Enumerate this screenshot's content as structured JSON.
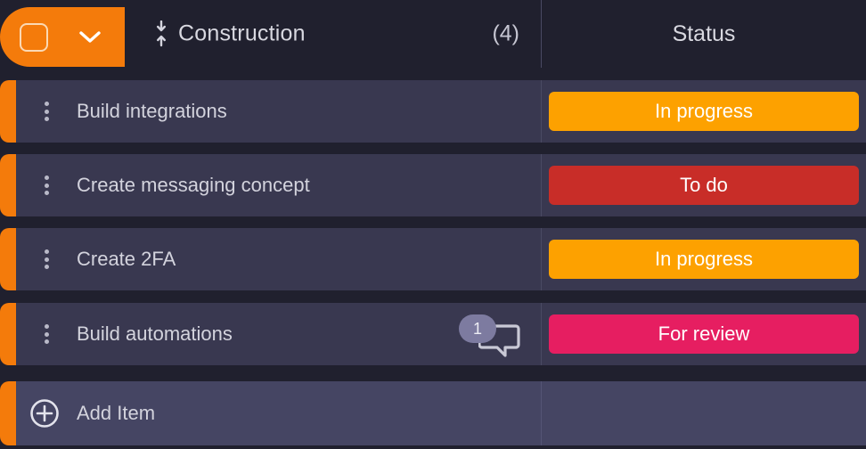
{
  "board": {
    "accent_color": "#F47B0B",
    "row_background": "#393850",
    "gap_background": "#20202E",
    "add_row_background": "#454563"
  },
  "header": {
    "checkbox_name": "select-all-checkbox",
    "checkbox_checked": false,
    "collapse_icon": "chevron-down-icon",
    "sort_icon": "sort-vertical-icon",
    "group_name": "Construction",
    "item_count": "(4)",
    "columns": [
      {
        "label": "Status"
      }
    ]
  },
  "rows": [
    {
      "title": "Build integrations",
      "menu_icon": "kebab-menu-icon",
      "status": {
        "label": "In progress",
        "color": "#FDA100"
      },
      "comments": null
    },
    {
      "title": "Create messaging concept",
      "menu_icon": "kebab-menu-icon",
      "status": {
        "label": "To do",
        "color": "#C82D28"
      },
      "comments": null
    },
    {
      "title": "Create 2FA",
      "menu_icon": "kebab-menu-icon",
      "status": {
        "label": "In progress",
        "color": "#FDA100"
      },
      "comments": null
    },
    {
      "title": "Build automations",
      "menu_icon": "kebab-menu-icon",
      "status": {
        "label": "For review",
        "color": "#E61E61"
      },
      "comments": {
        "count": "1",
        "badge_color": "#7D7BA0",
        "icon": "comment-bubble-icon"
      }
    }
  ],
  "add_row": {
    "label": "Add Item",
    "icon": "plus-circle-icon"
  }
}
